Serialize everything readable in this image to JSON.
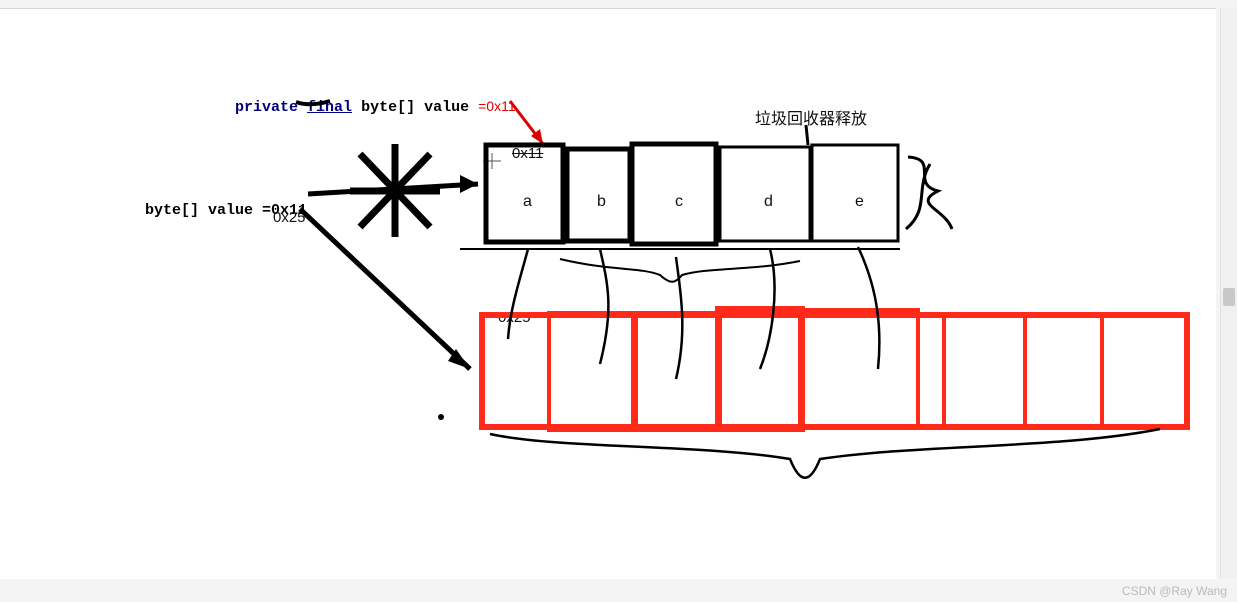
{
  "code": {
    "line1_private": "private",
    "line1_final": "final",
    "line1_rest": "byte[] value",
    "line1_addr": "=0x11",
    "line2_full": "byte[] value =0",
    "line2_addr_tail": "x11",
    "line2_addr_alt": "0x25"
  },
  "labels": {
    "gc_release": "垃圾回收器释放",
    "addr_top": "0x11",
    "addr_bottom": "0x25"
  },
  "black_array": {
    "cells": [
      "a",
      "b",
      "c",
      "d",
      "e"
    ]
  },
  "red_array": {
    "cells": [
      "",
      "",
      "",
      "",
      "",
      "",
      "",
      ""
    ]
  },
  "watermark": "CSDN @Ray Wang"
}
